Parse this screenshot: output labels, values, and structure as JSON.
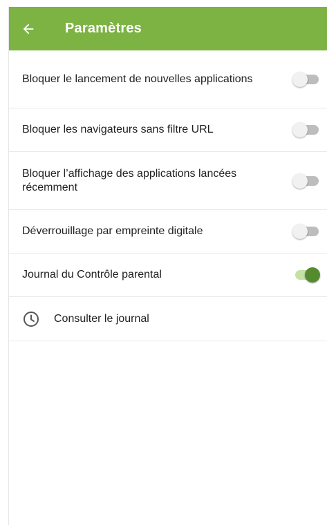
{
  "appbar": {
    "title": "Paramètres",
    "back_icon": "arrow-back-icon",
    "color": "#7cb342"
  },
  "settings": [
    {
      "label": "Bloquer le lancement de nouvelles applications",
      "enabled": false
    },
    {
      "label": "Bloquer les navigateurs sans filtre URL",
      "enabled": false
    },
    {
      "label": "Bloquer l’affichage des applications lancées récemment",
      "enabled": false
    },
    {
      "label": "Déverrouillage par empreinte digitale",
      "enabled": false
    },
    {
      "label": "Journal du Contrôle parental",
      "enabled": true
    }
  ],
  "journal": {
    "label": "Consulter le journal",
    "icon": "clock-icon"
  },
  "colors": {
    "switch_on_thumb": "#558b2f",
    "switch_on_track": "#c5e1a5",
    "switch_off_thumb": "#f1f1f1",
    "switch_off_track": "#bdbdbd"
  }
}
